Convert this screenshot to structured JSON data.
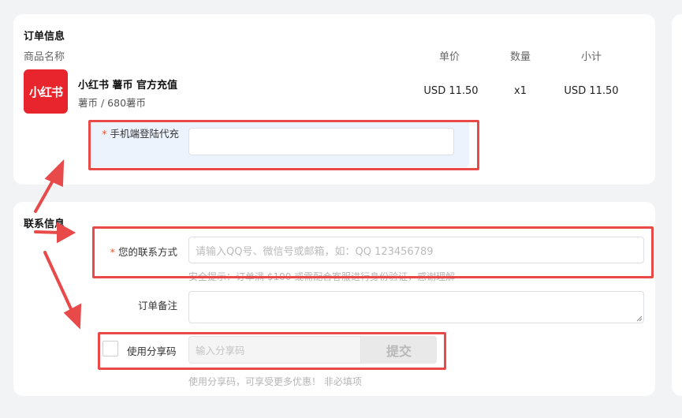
{
  "order": {
    "title": "订单信息",
    "columns": {
      "name": "商品名称",
      "unit_price": "单价",
      "quantity": "数量",
      "subtotal": "小计"
    },
    "product": {
      "logo_text": "小红书",
      "name": "小红书 薯币 官方充值",
      "variant": "薯币 / 680薯币",
      "unit_price": "USD 11.50",
      "quantity": "x1",
      "subtotal": "USD 11.50"
    },
    "phone_login": {
      "label": "手机端登陆代充",
      "value": ""
    }
  },
  "contact": {
    "title": "联系信息",
    "method": {
      "label": "您的联系方式",
      "placeholder": "请输入QQ号、微信号或邮箱，如：QQ 123456789",
      "hint": "安全提示：订单满 $100 或需配合客服进行身份验证，感谢理解"
    },
    "note": {
      "label": "订单备注",
      "value": ""
    },
    "share": {
      "label": "使用分享码",
      "placeholder": "输入分享码",
      "submit": "提交",
      "hint": "使用分享码，可享受更多优惠！ 非必填项"
    }
  },
  "colors": {
    "brand_red": "#e8252d",
    "annotation_red": "#e84a4a",
    "required_star": "#e8552a",
    "panel_blue": "#edf3fd"
  }
}
